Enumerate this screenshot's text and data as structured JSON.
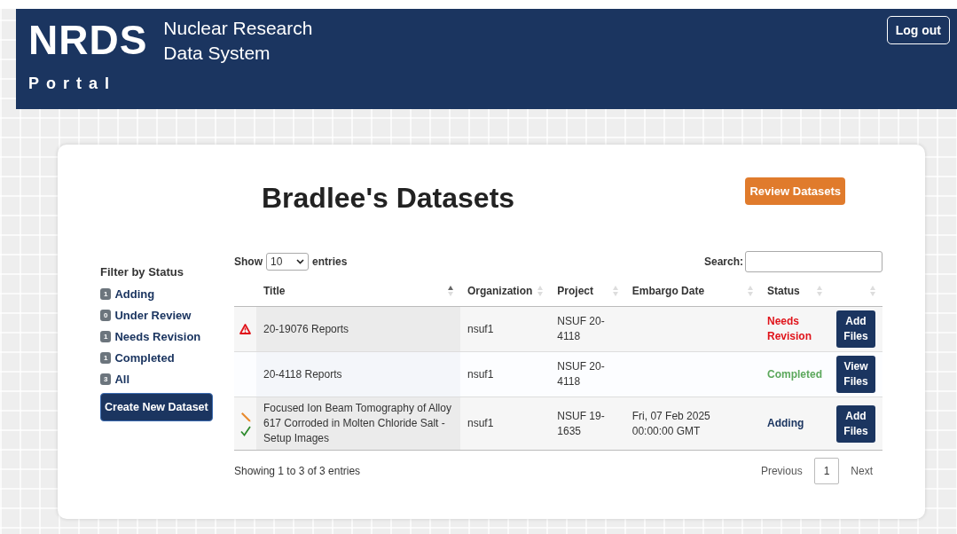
{
  "header": {
    "logo": "NRDS",
    "subtitle_lines": [
      "Nuclear Research",
      "Data System"
    ],
    "portal": "Portal",
    "logout": "Log out"
  },
  "page": {
    "title": "Bradlee's Datasets",
    "review_button": "Review Datasets"
  },
  "filter": {
    "heading": "Filter by Status",
    "items": [
      {
        "count": "1",
        "label": "Adding"
      },
      {
        "count": "0",
        "label": "Under Review"
      },
      {
        "count": "1",
        "label": "Needs Revision"
      },
      {
        "count": "1",
        "label": "Completed"
      },
      {
        "count": "3",
        "label": "All"
      }
    ],
    "create_button": "Create New Dataset"
  },
  "table": {
    "show_label": "Show",
    "page_size": "10",
    "entries_label": "entries",
    "search_label": "Search:",
    "columns": [
      {},
      {
        "label": "Title",
        "sorted": true
      },
      {
        "label": "Organization",
        "sorted": false
      },
      {
        "label": "Project",
        "sorted": false
      },
      {
        "label": "Embargo Date",
        "sorted": false
      },
      {
        "label": "Status",
        "sorted": false
      },
      {
        "sorted": false
      }
    ],
    "rows": [
      {
        "icons": [
          {
            "kind": "warning"
          }
        ],
        "title": "20-19076 Reports",
        "organization": "nsuf1",
        "project": "NSUF 20-4118",
        "status": "Needs Revision",
        "color": "#e0131a",
        "action": "Add Files"
      },
      {
        "title": "20-4118 Reports",
        "organization": "nsuf1",
        "project": "NSUF 20-4118",
        "status": "Completed",
        "color": "#5ca85c",
        "action": "View Files"
      },
      {
        "icons": [
          {
            "kind": "pencil"
          },
          {
            "kind": "check"
          }
        ],
        "title": "Focused Ion Beam Tomography of Alloy 617 Corroded in Molten Chloride Salt - Setup Images",
        "organization": "nsuf1",
        "project": "NSUF 19-1635",
        "embargo_date": "Fri, 07 Feb 2025 00:00:00 GMT",
        "status": "Adding",
        "color": "#1b3560",
        "action": "Add Files"
      }
    ],
    "info": "Showing 1 to 3 of 3 entries",
    "pagination": [
      {
        "label": "Previous",
        "selected": false
      },
      {
        "label": "1",
        "selected": true
      },
      {
        "label": "Next",
        "selected": false
      }
    ]
  }
}
